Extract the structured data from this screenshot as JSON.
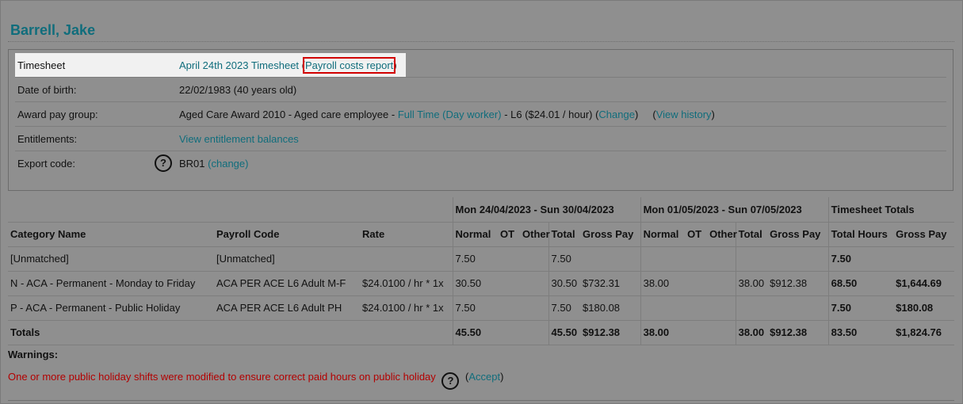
{
  "employee": {
    "name": "Barrell, Jake"
  },
  "info": {
    "timesheet": {
      "label": "Timesheet",
      "link": "April 24th 2023 Timesheet",
      "open": "(",
      "report_link": "Payroll costs report",
      "close": ")"
    },
    "dob": {
      "label": "Date of birth:",
      "value": "22/02/1983 (40 years old)"
    },
    "award": {
      "label": "Award pay group:",
      "prefix": "Aged Care Award 2010 - Aged care employee - ",
      "type_link": "Full Time (Day worker)",
      "level": " - L6 ($24.01 / hour) (",
      "change_link": "Change",
      "mid": ")     (",
      "history_link": "View history",
      "close": ")"
    },
    "entitlements": {
      "label": "Entitlements:",
      "link": "View entitlement balances"
    },
    "export": {
      "label": "Export code:",
      "help_icon": "question-circle-icon",
      "value": "BR01",
      "change_link": "(change)"
    }
  },
  "table": {
    "period1": "Mon 24/04/2023 - Sun 30/04/2023",
    "period2": "Mon 01/05/2023 - Sun 07/05/2023",
    "totals_header": "Timesheet Totals",
    "columns": {
      "category": "Category Name",
      "code": "Payroll Code",
      "rate": "Rate",
      "normal": "Normal",
      "ot": "OT",
      "other": "Other",
      "total": "Total",
      "gross": "Gross Pay",
      "total_hours": "Total Hours"
    },
    "rows": [
      {
        "category": "[Unmatched]",
        "code": "[Unmatched]",
        "rate": "",
        "p1_normal": "7.50",
        "p1_total": "7.50",
        "p1_gross": "",
        "p2_normal": "",
        "p2_total": "",
        "p2_gross": "",
        "hours": "7.50",
        "gross": ""
      },
      {
        "category": "N - ACA - Permanent - Monday to Friday",
        "code": "ACA PER ACE L6 Adult M-F",
        "rate": "$24.0100 / hr * 1x",
        "p1_normal": "30.50",
        "p1_total": "30.50",
        "p1_gross": "$732.31",
        "p2_normal": "38.00",
        "p2_total": "38.00",
        "p2_gross": "$912.38",
        "hours": "68.50",
        "gross": "$1,644.69"
      },
      {
        "category": "P - ACA - Permanent - Public Holiday",
        "code": "ACA PER ACE L6 Adult PH",
        "rate": "$24.0100 / hr * 1x",
        "p1_normal": "7.50",
        "p1_total": "7.50",
        "p1_gross": "$180.08",
        "p2_normal": "",
        "p2_total": "",
        "p2_gross": "",
        "hours": "7.50",
        "gross": "$180.08"
      }
    ],
    "totals": {
      "label": "Totals",
      "p1_normal": "45.50",
      "p1_total": "45.50",
      "p1_gross": "$912.38",
      "p2_normal": "38.00",
      "p2_total": "38.00",
      "p2_gross": "$912.38",
      "hours": "83.50",
      "gross": "$1,824.76"
    }
  },
  "warnings": {
    "label": "Warnings:",
    "message": "One or more public holiday shifts were modified to ensure correct paid hours on public holiday",
    "help_icon": "question-circle-icon",
    "accept_open": "(",
    "accept_link": "Accept",
    "accept_close": ")"
  },
  "colors": {
    "background": "#8f8f8f",
    "link": "#106d7c",
    "warning": "#b30000",
    "highlight": "#d10000"
  }
}
